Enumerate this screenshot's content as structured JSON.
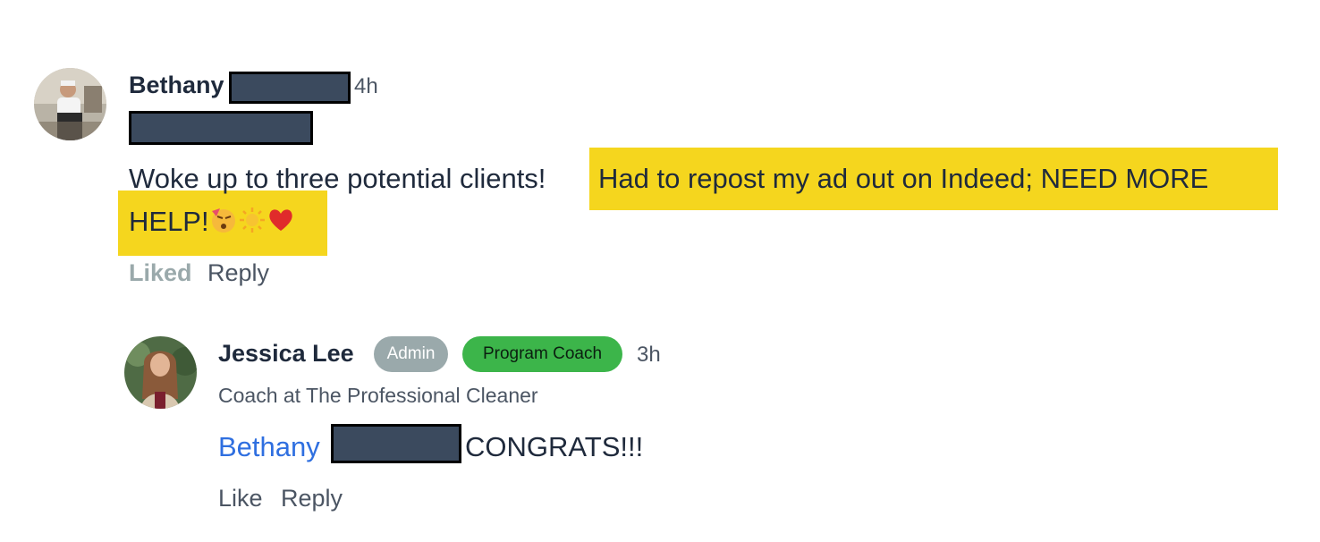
{
  "comment": {
    "author_first_name": "Bethany",
    "time": "4h",
    "body_plain": "Woke up to three potential clients!",
    "body_highlight_line1": "Had to repost my ad out on Indeed; NEED MORE",
    "body_highlight_line2": "HELP!",
    "emoji_icons": [
      "partying-face-icon",
      "sun-icon",
      "red-heart-icon"
    ],
    "liked_label": "Liked",
    "reply_label": "Reply",
    "highlight_color": "#f5d61e"
  },
  "reply": {
    "author_name": "Jessica Lee",
    "admin_badge": "Admin",
    "coach_badge": "Program Coach",
    "time": "3h",
    "subtitle": "Coach at The Professional Cleaner",
    "mention_name": "Bethany",
    "body": "CONGRATS!!!",
    "like_label": "Like",
    "reply_label": "Reply",
    "admin_badge_color": "#9aa9ab",
    "coach_badge_color": "#3cb54a",
    "mention_color": "#2f6fe0"
  }
}
